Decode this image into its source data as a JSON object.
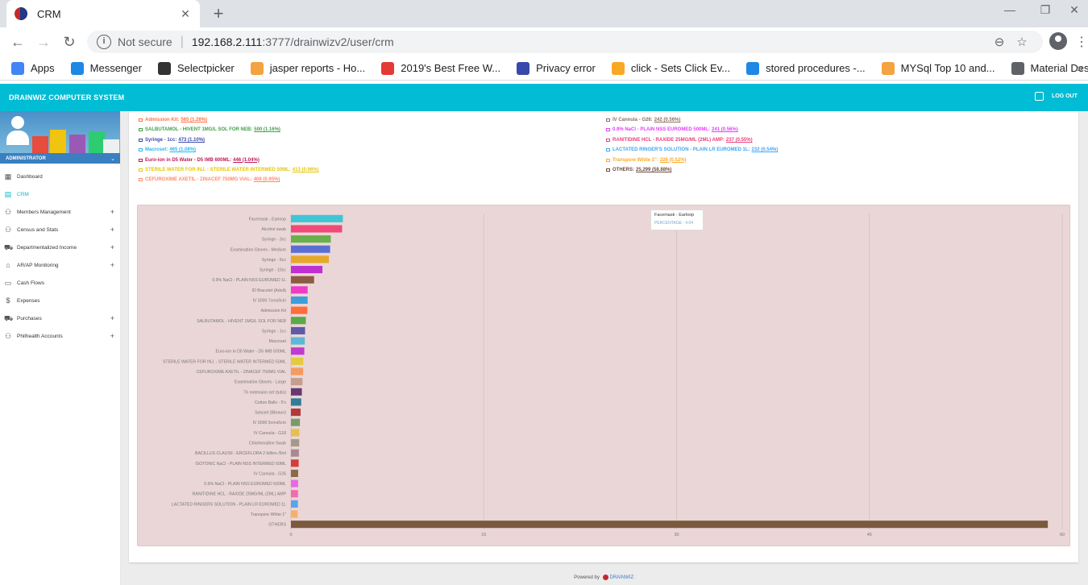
{
  "browser": {
    "tab_title": "CRM",
    "not_secure_label": "Not secure",
    "url_host": "192.168.2.111",
    "url_rest": ":3777/drainwizv2/user/crm",
    "bookmarks": [
      {
        "label": "Apps",
        "color": "#4285f4"
      },
      {
        "label": "Messenger",
        "color": "#1e88e5"
      },
      {
        "label": "Selectpicker",
        "color": "#333333"
      },
      {
        "label": "jasper reports - Ho...",
        "color": "#f4a340"
      },
      {
        "label": "2019's Best Free W...",
        "color": "#e53935"
      },
      {
        "label": "Privacy error",
        "color": "#3949ab"
      },
      {
        "label": "click - Sets Click Ev...",
        "color": "#f9a825"
      },
      {
        "label": "stored procedures -...",
        "color": "#1e88e5"
      },
      {
        "label": "MYSql Top 10 and...",
        "color": "#f4a340"
      },
      {
        "label": "Material Design Ico...",
        "color": "#5f6368"
      }
    ]
  },
  "app": {
    "title": "DRAINWIZ COMPUTER SYSTEM",
    "logout_label": "LOG OUT",
    "accent": "#00bcd4",
    "footer_prefix": "Powered by",
    "footer_brand": "DRAINWIZ."
  },
  "sidebar": {
    "role": "ADMINISTRATOR",
    "items": [
      {
        "label": "Dashboard",
        "icon": "dashboard-icon",
        "glyph": "▦",
        "plus": false,
        "active": false
      },
      {
        "label": "CRM",
        "icon": "crm-icon",
        "glyph": "▤",
        "plus": false,
        "active": true
      },
      {
        "label": "Members Management",
        "icon": "members-icon",
        "glyph": "⚇",
        "plus": true,
        "active": false
      },
      {
        "label": "Census and Stats",
        "icon": "census-icon",
        "glyph": "⚇",
        "plus": true,
        "active": false
      },
      {
        "label": "Departmentalized Income",
        "icon": "cart-icon",
        "glyph": "⛟",
        "plus": true,
        "active": false
      },
      {
        "label": "AR/AP Monitoring",
        "icon": "bank-icon",
        "glyph": "⌂",
        "plus": true,
        "active": false
      },
      {
        "label": "Cash Flows",
        "icon": "cash-icon",
        "glyph": "▭",
        "plus": false,
        "active": false
      },
      {
        "label": "Expenses",
        "icon": "dollar-icon",
        "glyph": "$",
        "plus": false,
        "active": false
      },
      {
        "label": "Purchases",
        "icon": "cart-icon",
        "glyph": "⛟",
        "plus": true,
        "active": false
      },
      {
        "label": "Philhealth Accounts",
        "icon": "members-icon",
        "glyph": "⚇",
        "plus": true,
        "active": false
      }
    ]
  },
  "legend_left": [
    {
      "name": "Admission Kit:",
      "value": "565 (1.28%)",
      "color": "#ff7043"
    },
    {
      "name": "SALBUTAMOL - HIVENT 1MG/L SOL FOR NEB:",
      "value": "500 (1.16%)",
      "color": "#43a047"
    },
    {
      "name": "Syringe - 1cc:",
      "value": "473 (1.10%)",
      "color": "#3949ab"
    },
    {
      "name": "Macroset:",
      "value": "465 (1.08%)",
      "color": "#29b6f6"
    },
    {
      "name": "Euro-ion in D5 Water - D5 IMB 600ML:",
      "value": "446 (1.04%)",
      "color": "#c2185b"
    },
    {
      "name": "STERILE WATER FOR INJ. - STERILE WATER INTERMED 50ML:",
      "value": "413 (0.96%)",
      "color": "#e6c600"
    },
    {
      "name": "CEFUROXIME AXETIL - ZINACEF 750MG VIAL:",
      "value": "408 (0.95%)",
      "color": "#ff8a65"
    }
  ],
  "legend_right": [
    {
      "name": "IV Cannula - G26:",
      "value": "242 (0.56%)",
      "color": "#8d6e63"
    },
    {
      "name": "0.9% NaCl - PLAIN NSS EUROMED 500ML:",
      "value": "241 (0.56%)",
      "color": "#e040fb"
    },
    {
      "name": "RANITIDINE HCL - RAXIDE 25MG/ML (2ML) AMP:",
      "value": "237 (0.55%)",
      "color": "#ec407a"
    },
    {
      "name": "LACTATED RINGER'S SOLUTION - PLAIN LR EUROMED 1L:",
      "value": "232 (0.54%)",
      "color": "#42a5f5"
    },
    {
      "name": "Transpore White 1\":",
      "value": "226 (0.52%)",
      "color": "#ffa726"
    },
    {
      "name": "OTHERS:",
      "value": "25,299 (58.88%)",
      "color": "#6d4c41"
    }
  ],
  "tooltip": {
    "title": "Facemask - Earloop",
    "value": "PERCENTAGE : 4.04"
  },
  "chart_data": {
    "type": "bar",
    "orientation": "horizontal",
    "categories": [
      "Facemask - Earloop",
      "Alcohol swab",
      "Syringe - 3cc",
      "Examination Gloves - Medium",
      "Syringe - 5cc",
      "Syringe - 10cc",
      "0.9% NaCl - PLAIN NSS EUROMED 1L",
      "ID Bracelet (Adult)",
      "IV 3000 7cmx9cm",
      "Admission Kit",
      "SALBUTAMOL - HIVENT 1MG/L SOL FOR NEB",
      "Syringe - 1cc",
      "Macroset",
      "Euro-ion in D5 Water - D5 IMB 500ML",
      "STERILE WATER FOR INJ. - STERILE WATER INTERMED 50ML",
      "CEFUROXIME AXETIL - ZINACEF 750MG VIAL",
      "Examination Gloves - Large",
      "Tri extension set (tubs)",
      "Cotton Balls - 5's",
      "Soluset (Bbraun)",
      "IV 3000 5cmx6cm",
      "IV Cannula - G18",
      "Chlorhexidine Swab",
      "BACILLUS CLAUSII - ERCEFLORA 2 billion /5ml",
      "ISOTONIC NaCl - PLAIN NSS INTERMED 50ML",
      "IV Cannula - G26",
      "0.9% NaCl - PLAIN NSS EUROMED 500ML",
      "RANITIDINE HCL - RAXIDE 25MG/ML (2ML) AMP",
      "LACTATED RINGERS SOLUTION - PLAIN LR EUROMED 1L",
      "Transpore White 1\"",
      "OTHERS"
    ],
    "values": [
      4.04,
      3.98,
      3.1,
      3.05,
      2.95,
      2.45,
      1.8,
      1.3,
      1.3,
      1.28,
      1.16,
      1.1,
      1.08,
      1.04,
      0.96,
      0.95,
      0.9,
      0.85,
      0.8,
      0.75,
      0.7,
      0.65,
      0.64,
      0.62,
      0.6,
      0.56,
      0.56,
      0.55,
      0.54,
      0.52,
      58.88
    ],
    "colors": [
      "#3ec6d6",
      "#ef4a78",
      "#6ab04c",
      "#5b6fd3",
      "#e5a82b",
      "#c02fd0",
      "#8d5a44",
      "#ee3cc6",
      "#3c9fd9",
      "#ff6d3a",
      "#5aa84a",
      "#5e5aa8",
      "#5cb8d8",
      "#c23bcf",
      "#e0cc3c",
      "#f49a63",
      "#c79d8c",
      "#6a3870",
      "#2e7d9a",
      "#b23a3a",
      "#7a9a6a",
      "#e3c050",
      "#a59a8a",
      "#a88a90",
      "#d63b3b",
      "#8a6a4a",
      "#e56ae6",
      "#f26ab0",
      "#5aa4ea",
      "#f4b06a",
      "#7a5a3e"
    ],
    "xlim": [
      0,
      60
    ],
    "xticks": [
      "0",
      "15",
      "30",
      "45",
      "60"
    ],
    "grid": true
  }
}
